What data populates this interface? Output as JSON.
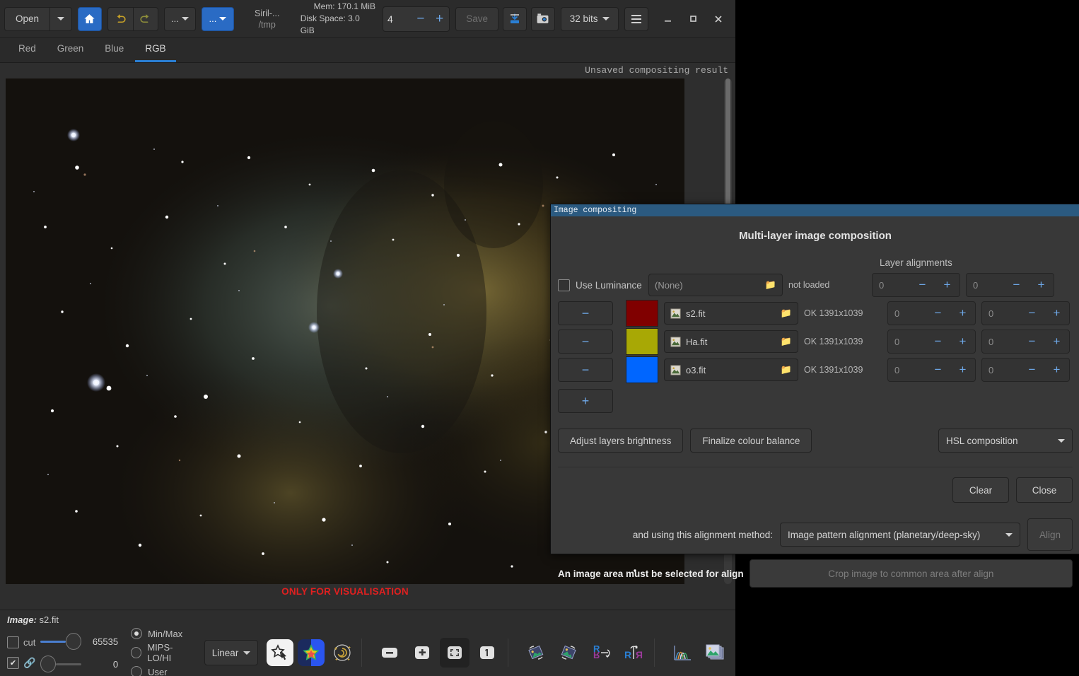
{
  "app": {
    "title_line1": "Siril-...",
    "title_line2": "/tmp",
    "mem": "Mem: 170.1 MiB",
    "disk": "Disk Space: 3.0 GiB"
  },
  "toolbar": {
    "open_label": "Open",
    "open_arrow_icon": "chevron-down-icon",
    "home_icon": "home-icon",
    "undo_icon": "undo-arrow-icon",
    "redo_icon": "redo-arrow-icon",
    "processing_label": "...",
    "tools_label": "...",
    "threads_value": "4",
    "minus_label": "−",
    "plus_label": "+",
    "save_label": "Save",
    "save_as_icon": "save-as-icon",
    "snapshot_icon": "camera-icon",
    "bitdepth_label": "32 bits",
    "menu_icon": "hamburger-menu-icon",
    "minimize_icon": "minimize-icon",
    "maximize_icon": "maximize-icon",
    "close_icon": "close-icon"
  },
  "tabs": [
    {
      "label": "Red",
      "active": false
    },
    {
      "label": "Green",
      "active": false
    },
    {
      "label": "Blue",
      "active": false
    },
    {
      "label": "RGB",
      "active": true
    }
  ],
  "viewport": {
    "unsaved_label": "Unsaved compositing result",
    "visualisation_warning": "ONLY FOR VISUALISATION"
  },
  "status": {
    "image_key": "Image:",
    "image_name": "s2.fit",
    "cut_label": "cut",
    "hi_value": "65535",
    "lo_value": "0",
    "link_icon": "chain-link-icon",
    "display_modes": [
      {
        "label": "Min/Max",
        "selected": true
      },
      {
        "label": "MIPS-LO/HI",
        "selected": false
      },
      {
        "label": "User",
        "selected": false
      }
    ],
    "stretch_mode": "Linear",
    "icons": [
      "star-cursor-icon",
      "photometry-star-icon",
      "galaxy-annotate-icon",
      "zoom-out-icon",
      "zoom-in-icon",
      "zoom-fit-icon",
      "zoom-one-to-one-icon",
      "rotate-left-icon",
      "rotate-right-icon",
      "mirror-vertical-icon",
      "mirror-horizontal-icon",
      "histogram-icon",
      "frame-list-icon"
    ]
  },
  "dialog": {
    "window_title": "Image compositing",
    "heading": "Multi-layer image composition",
    "layer_alignments_title": "Layer alignments",
    "luminance": {
      "checkbox_label": "Use Luminance",
      "checked": false,
      "file_label": "(None)",
      "status": "not loaded",
      "align_x": "0",
      "align_y": "0"
    },
    "layers": [
      {
        "color": "#800000",
        "file": "s2.fit",
        "status": "OK 1391x1039",
        "align_x": "0",
        "align_y": "0"
      },
      {
        "color": "#a8a805",
        "file": "Ha.fit",
        "status": "OK 1391x1039",
        "align_x": "0",
        "align_y": "0"
      },
      {
        "color": "#0066ff",
        "file": "o3.fit",
        "status": "OK 1391x1039",
        "align_x": "0",
        "align_y": "0"
      }
    ],
    "remove_layer_label": "−",
    "add_layer_label": "+",
    "folder_icon": "folder-open-icon",
    "image_icon": "image-thumbnail-icon",
    "adjust_brightness_label": "Adjust layers brightness",
    "finalize_balance_label": "Finalize colour balance",
    "composition_mode": "HSL composition",
    "clear_label": "Clear",
    "close_label": "Close",
    "alignment_method_label": "and using this alignment method:",
    "alignment_method": "Image pattern alignment (planetary/deep-sky)",
    "align_button_label": "Align",
    "warning_text": "An image area must be selected for align",
    "crop_label": "Crop image to common area after align"
  },
  "colors": {
    "accent_blue": "#2a6bc4",
    "titlebar_blue": "#2b5a80",
    "warning_red": "#e02020",
    "spin_blue": "#6ea8e8"
  }
}
